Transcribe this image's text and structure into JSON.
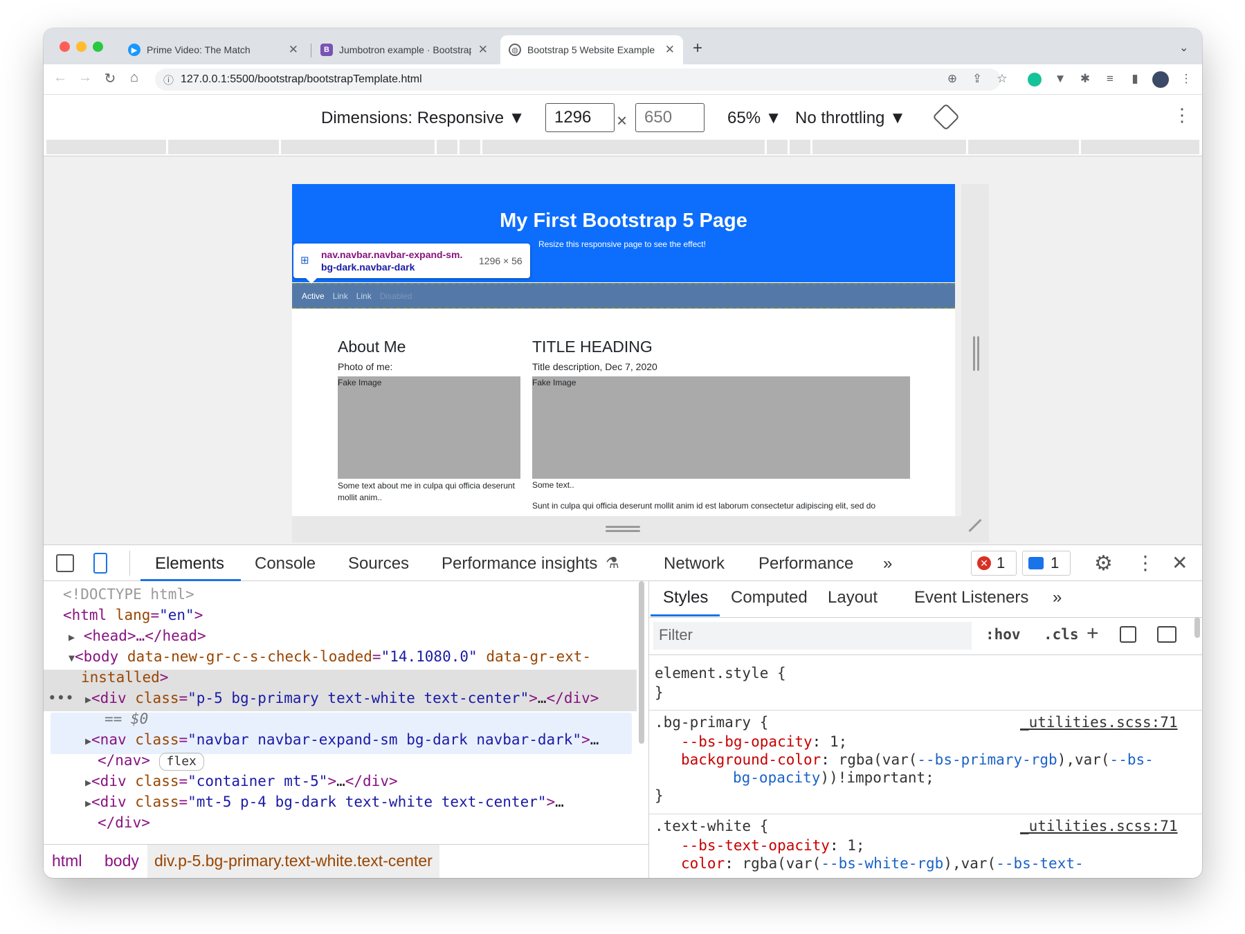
{
  "browser": {
    "tabs": [
      {
        "title": "Prime Video: The Match",
        "active": false
      },
      {
        "title": "Jumbotron example · Bootstrap",
        "active": false
      },
      {
        "title": "Bootstrap 5 Website Example",
        "active": true
      }
    ],
    "url": "127.0.0.1:5500/bootstrap/bootstrapTemplate.html"
  },
  "device_toolbar": {
    "dimensions_label": "Dimensions: Responsive ▼",
    "width": "1296",
    "height": "650",
    "times": "×",
    "zoom": "65% ▼",
    "throttling": "No throttling ▼"
  },
  "page": {
    "title": "My First Bootstrap 5 Page",
    "subtitle": "Resize this responsive page to see the effect!",
    "nav_links": [
      "Active",
      "Link",
      "Link",
      "Disabled"
    ],
    "tooltip_selector_1": "nav.navbar.navbar-expand-sm.",
    "tooltip_selector_2": "bg-dark.navbar-dark",
    "tooltip_size": "1296 × 56",
    "about_heading": "About Me",
    "photo_label": "Photo of me:",
    "fake_image": "Fake Image",
    "about_text": "Some text about me in culpa qui officia deserunt mollit anim..",
    "title_heading": "TITLE HEADING",
    "title_desc": "Title description, Dec 7, 2020",
    "some_text": "Some text..",
    "body_text": "Sunt in culpa qui officia deserunt mollit anim id est laborum consectetur adipiscing elit, sed do"
  },
  "devtools": {
    "tabs": [
      "Elements",
      "Console",
      "Sources",
      "Performance insights",
      "Network",
      "Performance",
      "»"
    ],
    "error_count": "1",
    "message_count": "1",
    "dom": {
      "doctype": "<!DOCTYPE html>",
      "html_open": "<html",
      "html_lang_attr": "lang",
      "html_lang_val": "\"en\"",
      "head": "<head>…</head>",
      "body_tag": "<body",
      "body_attr1": "data-new-gr-c-s-check-loaded",
      "body_val1": "\"14.1080.0\"",
      "body_attr2": "data-gr-ext-",
      "body_attr2b": "installed",
      "div1_attr_val": "\"p-5 bg-primary text-white text-center\"",
      "selected_marker": "== $0",
      "nav_attr_val": "\"navbar navbar-expand-sm bg-dark navbar-dark\"",
      "nav_close": "</nav>",
      "flex_badge": "flex",
      "div2_attr_val": "\"container mt-5\"",
      "div3_attr_val": "\"mt-5 p-4 bg-dark text-white text-center\"",
      "div_close": "</div>",
      "ellipsis": "…"
    },
    "breadcrumbs": [
      "html",
      "body",
      "div.p-5.bg-primary.text-white.text-center"
    ],
    "styles_tabs": [
      "Styles",
      "Computed",
      "Layout",
      "Event Listeners",
      "»"
    ],
    "filter_placeholder": "Filter",
    "hov": ":hov",
    "cls": ".cls",
    "element_style": "element.style {",
    "close_brace": "}",
    "rule1_selector": ".bg-primary {",
    "rule1_source": "_utilities.scss:71",
    "rule1_p1": "--bs-bg-opacity",
    "rule1_v1": "1;",
    "rule1_p2": "background-color",
    "rule1_v2a": "rgba(var(",
    "rule1_v2b": "--bs-primary-rgb",
    "rule1_v2c": "),var(",
    "rule1_v2d": "--bs-",
    "rule1_v2e": "bg-opacity",
    "rule1_v2f": "))!important;",
    "rule2_selector": ".text-white {",
    "rule2_source": "_utilities.scss:71",
    "rule2_p1": "--bs-text-opacity",
    "rule2_v1": "1;",
    "rule2_p2": "color",
    "rule2_v2a": "rgba(var(",
    "rule2_v2b": "--bs-white-rgb",
    "rule2_v2c": "),var(",
    "rule2_v2d": "--bs-text-"
  }
}
